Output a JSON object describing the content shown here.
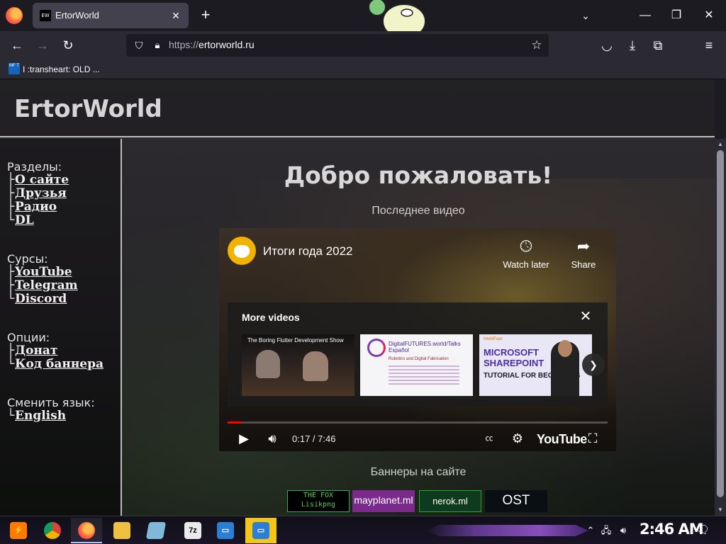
{
  "browser": {
    "tab_title": "ErtorWorld",
    "tab_favicon_text": "EW",
    "url_protocol": "https://",
    "url_host": "ertorworld.ru",
    "bookmark_label": "I :transheart: OLD ...",
    "bookmark_icon_text": "MF T",
    "accent_color": "#ff7139"
  },
  "site": {
    "title": "ErtorWorld",
    "main_title": "Добро пожаловать!",
    "subtitle": "Последнее видео",
    "banners_title": "Баннеры на сайте"
  },
  "sidebar": {
    "sections_heading": "Разделы:",
    "sections": [
      "О сайте",
      "Друзья",
      "Радио",
      "DL"
    ],
    "sources_heading": "Сурсы:",
    "sources": [
      "YouTube",
      "Telegram",
      "Discord"
    ],
    "options_heading": "Опции:",
    "options": [
      "Донат",
      "Код баннера"
    ],
    "language_heading": "Сменить язык:",
    "language": [
      "English"
    ]
  },
  "video": {
    "title": "Итоги года 2022",
    "watch_later": "Watch later",
    "share": "Share",
    "more_videos": "More videos",
    "thumb1_caption": "The Boring Flutter Development Show",
    "thumb2_caption": "DigitalFUTURES.world/Talks Español",
    "thumb2_sub": "Robotics and Digital Fabrication",
    "thumb3_brand": "IntelliPaat",
    "thumb3_big": "MICROSOFT SHAREPOINT",
    "thumb3_small": "TUTORIAL FOR BEGINNERS",
    "time": "0:17 / 7:46",
    "progress": 0.037,
    "youtube_logo": "YouTube"
  },
  "banners": {
    "b1_line1": "THE FOX",
    "b1_line2": "Lisikpng",
    "b2": "mayplanet.ml",
    "b3": "nerok.ml",
    "b4": "OST"
  },
  "taskbar": {
    "clock": "2:46 AM",
    "apps": [
      "start-icon",
      "chrome-icon",
      "firefox-icon",
      "file-explorer-icon",
      "notes-icon",
      "7zip-icon",
      "remote-desktop-icon",
      "remote-desktop-active-icon"
    ],
    "zip_label": "7z"
  }
}
